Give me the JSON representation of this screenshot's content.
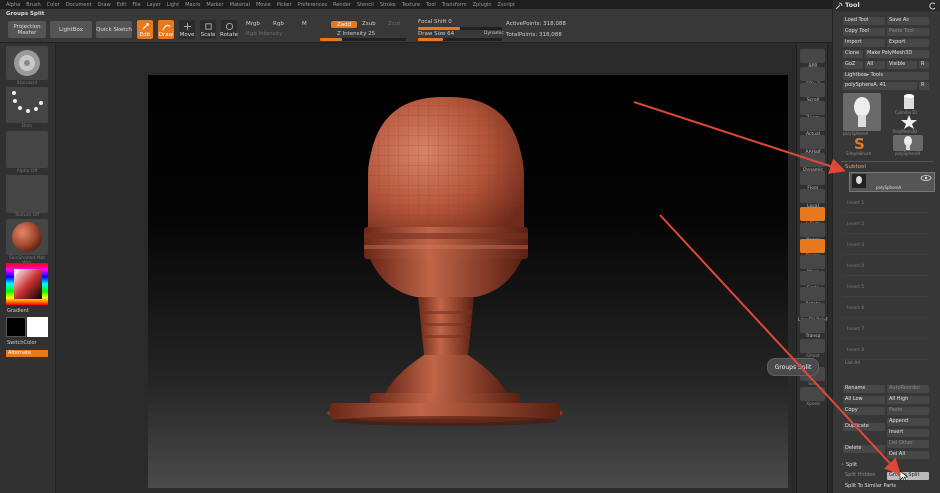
{
  "menu": [
    "Alpha",
    "Brush",
    "Color",
    "Document",
    "Draw",
    "Edit",
    "File",
    "Layer",
    "Light",
    "Macro",
    "Marker",
    "Material",
    "Movie",
    "Picker",
    "Preferences",
    "Render",
    "Stencil",
    "Stroke",
    "Texture",
    "Tool",
    "Transform",
    "Zplugin",
    "Zscript"
  ],
  "toolbar": {
    "palette_title": "Groups Split",
    "projection_master": "Projection Master",
    "lightbox": "LightBox",
    "quick_sketch": "Quick Sketch",
    "edit": "Edit",
    "draw": "Draw",
    "move": "Move",
    "scale": "Scale",
    "rotate": "Rotate",
    "mrgb": "Mrgb",
    "rgb": "Rgb",
    "m": "M",
    "rgb_intensity": "Rgb Intensity",
    "zadd": "Zadd",
    "zsub": "Zsub",
    "zcut": "Zcut",
    "z_intensity_label": "Z Intensity 25",
    "z_intensity": 25,
    "focal_shift_label": "Focal Shift 0",
    "draw_size_label": "Draw Size 64",
    "dynamic": "Dynamic",
    "active_points": "ActivePoints: 318,088",
    "total_points": "TotalPoints: 318,088"
  },
  "left_shelf": {
    "brush_label": "Standard",
    "stroke_label": "Dots",
    "alpha_label": "Alpha Off",
    "texture_label": "Texture Off",
    "material_label": "SkinShade4 Mat Wax",
    "gradient": "Gradient",
    "switch_color": "SwitchColor",
    "alternate": "Alternate"
  },
  "right_shelf": [
    "BPR",
    "SPix 3",
    "Scroll",
    "Zoom",
    "Actual",
    "AAHalf",
    "Dynamic Persp",
    "Floor",
    "Local",
    "L.Sym",
    "Xpose",
    "Frame",
    "Move",
    "Scale",
    "Rotate",
    "Line Fill PolyF",
    "Transp",
    "Ghost",
    "Solo",
    "Xpose"
  ],
  "tool_panel": {
    "title": "Tool",
    "load_tool": "Load Tool",
    "save_as": "Save As",
    "copy_tool": "Copy Tool",
    "paste_tool": "Paste Tool",
    "import": "Import",
    "export": "Export",
    "clone": "Clone",
    "make_polymesh": "Make PolyMesh3D",
    "goz": "GoZ",
    "all": "All",
    "visible": "Visible",
    "r": "R",
    "lightbox_tools": "Lightbox▸ Tools",
    "current_tool": "polySphereA. 41",
    "tool_thumbs": [
      "polySphereA",
      "Cylinder3D",
      "SimpleBrush",
      "PolyMesh3D",
      "polySphereA"
    ],
    "subtool": "Subtool",
    "subtool_item": "polySphereA",
    "subtool_slots": [
      "Insert 1",
      "Insert 2",
      "Insert 3",
      "Insert 4",
      "Insert 5",
      "Insert 6",
      "Insert 7",
      "Insert 8"
    ],
    "list_all": "List All",
    "rename": "Rename",
    "auto_reorder": "AutoReorder",
    "all_low": "All Low",
    "all_high": "All High",
    "copy": "Copy",
    "paste": "Paste",
    "append": "Append",
    "duplicate": "Duplicate",
    "insert": "Insert",
    "del_other": "Del Other",
    "delete": "Delete",
    "del_all": "Del All",
    "split": "Split",
    "split_hidden": "Split Hidden",
    "groups_split": "Groups Split",
    "split_to_similar": "Split To Similar Parts"
  },
  "tooltip": "Groups Split",
  "colors": {
    "accent": "#e8781e",
    "model": "#b85a3e",
    "annotation": "#e0473a"
  }
}
